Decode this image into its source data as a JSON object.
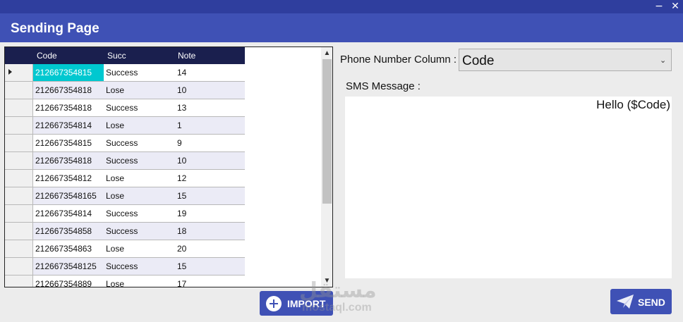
{
  "window": {
    "title": "Sending Page",
    "minimize_glyph": "−",
    "close_glyph": "✕"
  },
  "grid": {
    "columns": [
      "Code",
      "Succ",
      "Note"
    ],
    "rows": [
      {
        "code": "212667354815",
        "succ": "Success",
        "note": "14"
      },
      {
        "code": "212667354818",
        "succ": "Lose",
        "note": "10"
      },
      {
        "code": "212667354818",
        "succ": "Success",
        "note": "13"
      },
      {
        "code": "212667354814",
        "succ": "Lose",
        "note": "1"
      },
      {
        "code": "212667354815",
        "succ": "Success",
        "note": "9"
      },
      {
        "code": "212667354818",
        "succ": "Success",
        "note": "10"
      },
      {
        "code": "212667354812",
        "succ": "Lose",
        "note": "12"
      },
      {
        "code": "2126673548165",
        "succ": "Lose",
        "note": "15"
      },
      {
        "code": "212667354814",
        "succ": "Success",
        "note": "19"
      },
      {
        "code": "212667354858",
        "succ": "Success",
        "note": "18"
      },
      {
        "code": "212667354863",
        "succ": "Lose",
        "note": "20"
      },
      {
        "code": "2126673548125",
        "succ": "Success",
        "note": "15"
      },
      {
        "code": "212667354889",
        "succ": "Lose",
        "note": "17"
      }
    ],
    "selected_row": 0,
    "scroll_up_glyph": "▲",
    "scroll_down_glyph": "▼"
  },
  "form": {
    "phone_label": "Phone Number Column :",
    "phone_value": "Code",
    "dropdown_glyph": "⌄",
    "sms_label": "SMS Message :",
    "sms_text": "Hello ($Code)"
  },
  "buttons": {
    "import": "IMPORT",
    "send": "SEND"
  },
  "watermark": {
    "arabic": "مستقل",
    "latin": "mostaql.com"
  },
  "colors": {
    "accent": "#3f51b5",
    "header_dark": "#1a1f4e",
    "selection": "#00c8d0"
  },
  "icons": {
    "import": "plus-circle-icon",
    "send": "paper-plane-icon"
  }
}
